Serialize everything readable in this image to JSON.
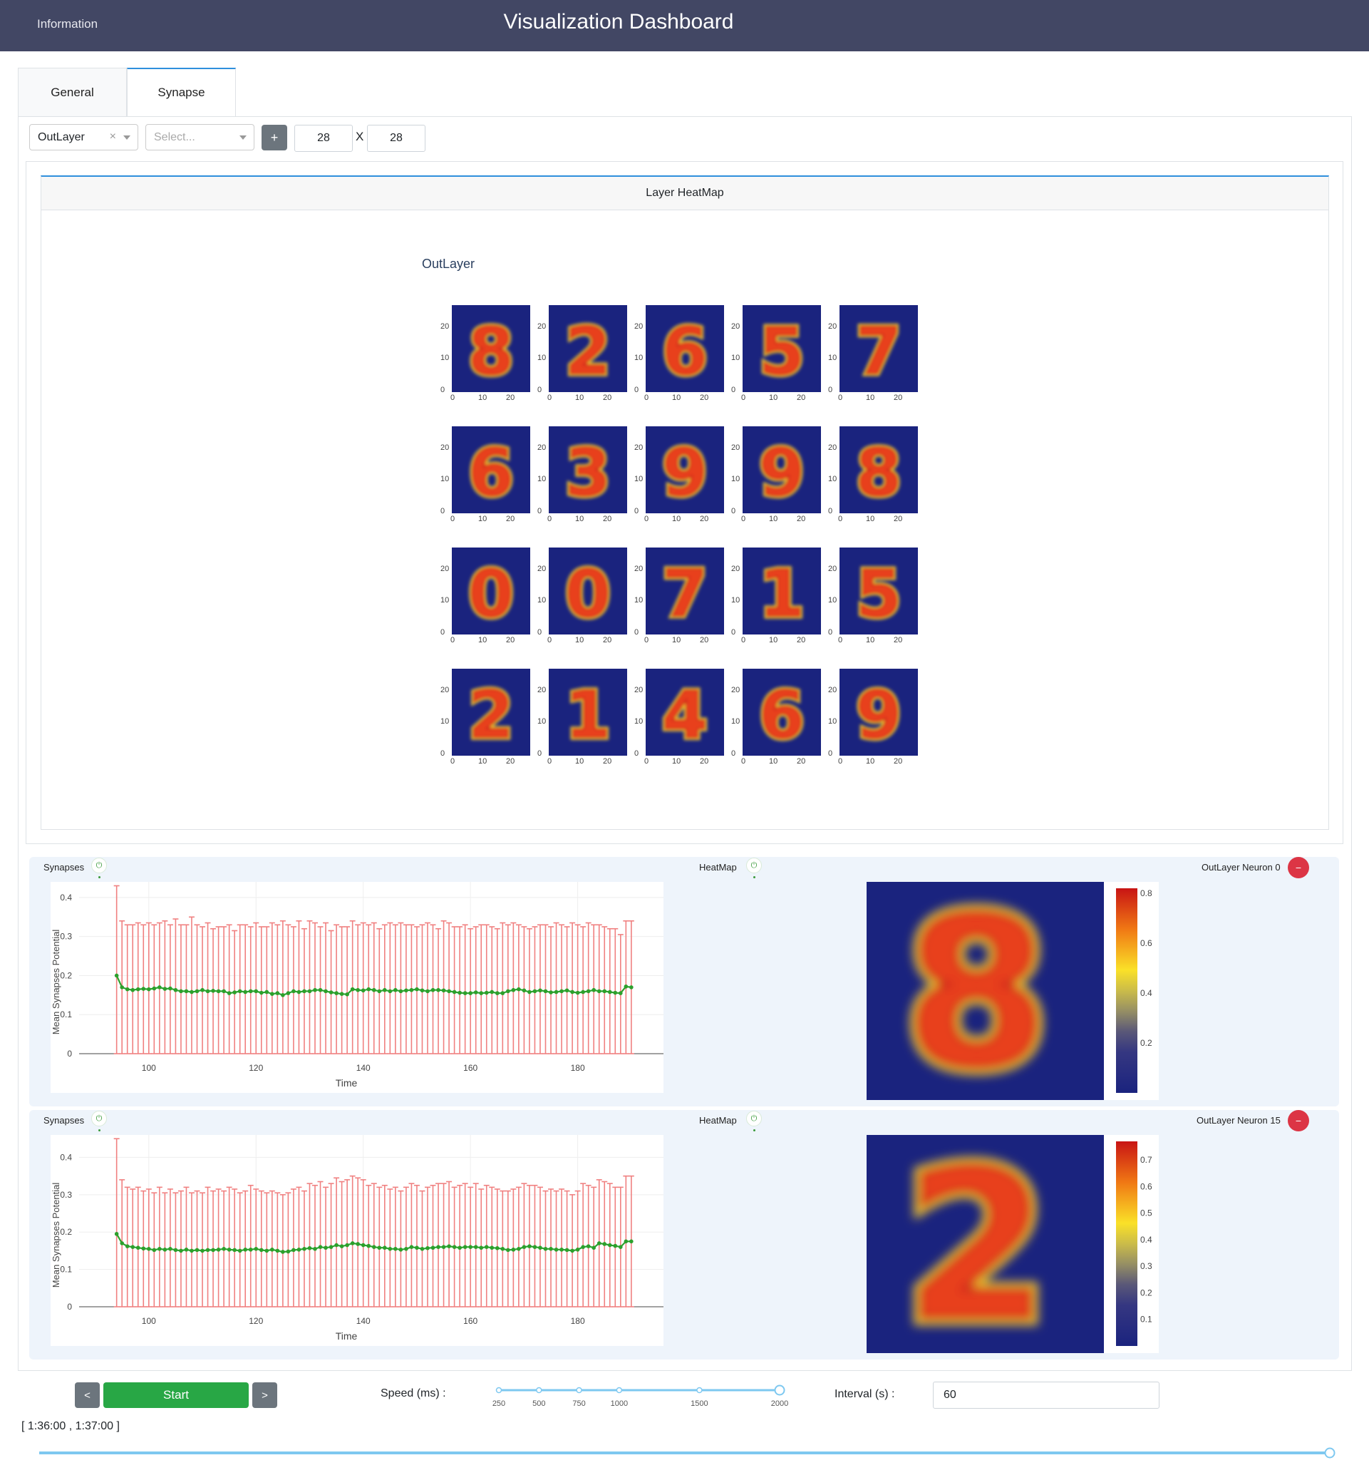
{
  "header": {
    "info_link": "Information",
    "title": "Visualization Dashboard"
  },
  "tabs": [
    {
      "label": "General",
      "active": false
    },
    {
      "label": "Synapse",
      "active": true
    }
  ],
  "controls": {
    "layer_select_value": "OutLayer",
    "neuron_select_placeholder": "Select...",
    "add_label": "+",
    "width_value": "28",
    "times_label": "X",
    "height_value": "28"
  },
  "heatmap_card": {
    "header": "Layer HeatMap",
    "grid_title": "OutLayer",
    "digits": [
      [
        "8",
        "2",
        "6",
        "5",
        "7"
      ],
      [
        "6",
        "3",
        "9",
        "9",
        "8"
      ],
      [
        "0",
        "0",
        "7",
        "1",
        "5"
      ],
      [
        "2",
        "1",
        "4",
        "6",
        "9"
      ]
    ],
    "y_ticks": [
      "20",
      "10",
      "0"
    ],
    "x_ticks": [
      "0",
      "10",
      "20"
    ]
  },
  "rows": [
    {
      "synapses_label": "Synapses",
      "heatmap_label": "HeatMap",
      "neuron_label": "OutLayer Neuron 0",
      "remove_label": "−",
      "power_icon": "⏻",
      "digit": "8",
      "colorbar_ticks": [
        "0.8",
        "0.6",
        "0.4",
        "0.2"
      ],
      "colorbar_max": 0.82,
      "colorbar_values": [
        0.8,
        0.6,
        0.4,
        0.2
      ]
    },
    {
      "synapses_label": "Synapses",
      "heatmap_label": "HeatMap",
      "neuron_label": "OutLayer Neuron 15",
      "remove_label": "−",
      "power_icon": "⏻",
      "digit": "2",
      "colorbar_ticks": [
        "0.7",
        "0.6",
        "0.5",
        "0.4",
        "0.3",
        "0.2",
        "0.1"
      ],
      "colorbar_max": 0.77,
      "colorbar_values": [
        0.7,
        0.6,
        0.5,
        0.4,
        0.3,
        0.2,
        0.1
      ]
    }
  ],
  "chart_data": [
    {
      "type": "line",
      "title": "",
      "xlabel": "Time",
      "ylabel": "Mean Synapses Potential",
      "xlim": [
        87,
        196
      ],
      "ylim": [
        0,
        0.44
      ],
      "x_ticks": [
        100,
        120,
        140,
        160,
        180
      ],
      "y_ticks": [
        0,
        0.1,
        0.2,
        0.3,
        0.4
      ],
      "x": [
        94,
        95,
        96,
        97,
        98,
        99,
        100,
        101,
        102,
        103,
        104,
        105,
        106,
        107,
        108,
        109,
        110,
        111,
        112,
        113,
        114,
        115,
        116,
        117,
        118,
        119,
        120,
        121,
        122,
        123,
        124,
        125,
        126,
        127,
        128,
        129,
        130,
        131,
        132,
        133,
        134,
        135,
        136,
        137,
        138,
        139,
        140,
        141,
        142,
        143,
        144,
        145,
        146,
        147,
        148,
        149,
        150,
        151,
        152,
        153,
        154,
        155,
        156,
        157,
        158,
        159,
        160,
        161,
        162,
        163,
        164,
        165,
        166,
        167,
        168,
        169,
        170,
        171,
        172,
        173,
        174,
        175,
        176,
        177,
        178,
        179,
        180,
        181,
        182,
        183,
        184,
        185,
        186,
        187,
        188,
        189,
        190
      ],
      "mean": [
        0.2,
        0.17,
        0.165,
        0.163,
        0.165,
        0.166,
        0.165,
        0.167,
        0.17,
        0.166,
        0.167,
        0.163,
        0.16,
        0.16,
        0.158,
        0.16,
        0.163,
        0.16,
        0.161,
        0.16,
        0.16,
        0.155,
        0.157,
        0.16,
        0.158,
        0.16,
        0.16,
        0.156,
        0.158,
        0.153,
        0.155,
        0.15,
        0.155,
        0.16,
        0.158,
        0.16,
        0.16,
        0.163,
        0.163,
        0.16,
        0.157,
        0.155,
        0.153,
        0.152,
        0.165,
        0.163,
        0.162,
        0.165,
        0.163,
        0.16,
        0.163,
        0.16,
        0.163,
        0.16,
        0.162,
        0.163,
        0.165,
        0.162,
        0.16,
        0.163,
        0.163,
        0.162,
        0.16,
        0.158,
        0.156,
        0.155,
        0.155,
        0.157,
        0.155,
        0.156,
        0.158,
        0.155,
        0.155,
        0.16,
        0.163,
        0.165,
        0.162,
        0.158,
        0.16,
        0.162,
        0.16,
        0.157,
        0.158,
        0.16,
        0.162,
        0.158,
        0.156,
        0.158,
        0.16,
        0.163,
        0.16,
        0.16,
        0.158,
        0.156,
        0.155,
        0.172,
        0.17
      ],
      "upper": [
        0.43,
        0.34,
        0.33,
        0.33,
        0.335,
        0.33,
        0.335,
        0.33,
        0.335,
        0.34,
        0.33,
        0.345,
        0.33,
        0.33,
        0.35,
        0.33,
        0.325,
        0.335,
        0.32,
        0.325,
        0.325,
        0.33,
        0.315,
        0.33,
        0.33,
        0.325,
        0.335,
        0.325,
        0.325,
        0.335,
        0.33,
        0.34,
        0.33,
        0.325,
        0.34,
        0.32,
        0.34,
        0.335,
        0.325,
        0.335,
        0.315,
        0.33,
        0.325,
        0.325,
        0.34,
        0.33,
        0.335,
        0.33,
        0.335,
        0.32,
        0.33,
        0.335,
        0.33,
        0.335,
        0.33,
        0.33,
        0.325,
        0.33,
        0.335,
        0.33,
        0.32,
        0.34,
        0.335,
        0.325,
        0.325,
        0.33,
        0.32,
        0.325,
        0.33,
        0.33,
        0.325,
        0.32,
        0.335,
        0.33,
        0.335,
        0.33,
        0.325,
        0.32,
        0.325,
        0.33,
        0.33,
        0.325,
        0.335,
        0.33,
        0.325,
        0.335,
        0.33,
        0.325,
        0.335,
        0.33,
        0.33,
        0.325,
        0.32,
        0.32,
        0.305,
        0.34,
        0.34
      ],
      "lower": 0.0
    },
    {
      "type": "line",
      "title": "",
      "xlabel": "Time",
      "ylabel": "Mean Synapses Potential",
      "xlim": [
        87,
        196
      ],
      "ylim": [
        0,
        0.46
      ],
      "x_ticks": [
        100,
        120,
        140,
        160,
        180
      ],
      "y_ticks": [
        0,
        0.1,
        0.2,
        0.3,
        0.4
      ],
      "x": [
        94,
        95,
        96,
        97,
        98,
        99,
        100,
        101,
        102,
        103,
        104,
        105,
        106,
        107,
        108,
        109,
        110,
        111,
        112,
        113,
        114,
        115,
        116,
        117,
        118,
        119,
        120,
        121,
        122,
        123,
        124,
        125,
        126,
        127,
        128,
        129,
        130,
        131,
        132,
        133,
        134,
        135,
        136,
        137,
        138,
        139,
        140,
        141,
        142,
        143,
        144,
        145,
        146,
        147,
        148,
        149,
        150,
        151,
        152,
        153,
        154,
        155,
        156,
        157,
        158,
        159,
        160,
        161,
        162,
        163,
        164,
        165,
        166,
        167,
        168,
        169,
        170,
        171,
        172,
        173,
        174,
        175,
        176,
        177,
        178,
        179,
        180,
        181,
        182,
        183,
        184,
        185,
        186,
        187,
        188,
        189,
        190
      ],
      "mean": [
        0.195,
        0.17,
        0.162,
        0.16,
        0.158,
        0.156,
        0.155,
        0.152,
        0.155,
        0.153,
        0.155,
        0.152,
        0.15,
        0.153,
        0.15,
        0.152,
        0.15,
        0.152,
        0.152,
        0.153,
        0.155,
        0.153,
        0.152,
        0.15,
        0.153,
        0.153,
        0.155,
        0.152,
        0.15,
        0.153,
        0.15,
        0.147,
        0.148,
        0.152,
        0.153,
        0.155,
        0.157,
        0.155,
        0.16,
        0.158,
        0.16,
        0.165,
        0.162,
        0.165,
        0.17,
        0.168,
        0.165,
        0.163,
        0.16,
        0.158,
        0.158,
        0.155,
        0.155,
        0.153,
        0.155,
        0.16,
        0.158,
        0.155,
        0.157,
        0.158,
        0.16,
        0.16,
        0.162,
        0.16,
        0.158,
        0.16,
        0.16,
        0.16,
        0.158,
        0.16,
        0.158,
        0.157,
        0.155,
        0.152,
        0.153,
        0.155,
        0.16,
        0.162,
        0.16,
        0.158,
        0.155,
        0.155,
        0.153,
        0.153,
        0.152,
        0.15,
        0.153,
        0.16,
        0.162,
        0.158,
        0.17,
        0.168,
        0.165,
        0.163,
        0.16,
        0.175,
        0.175
      ],
      "upper": [
        0.45,
        0.34,
        0.32,
        0.315,
        0.32,
        0.31,
        0.315,
        0.305,
        0.32,
        0.305,
        0.315,
        0.305,
        0.31,
        0.32,
        0.305,
        0.31,
        0.305,
        0.32,
        0.31,
        0.315,
        0.31,
        0.32,
        0.315,
        0.305,
        0.31,
        0.325,
        0.315,
        0.31,
        0.305,
        0.31,
        0.305,
        0.3,
        0.305,
        0.315,
        0.32,
        0.31,
        0.33,
        0.325,
        0.335,
        0.32,
        0.33,
        0.345,
        0.335,
        0.34,
        0.35,
        0.345,
        0.34,
        0.325,
        0.33,
        0.32,
        0.325,
        0.315,
        0.32,
        0.31,
        0.32,
        0.33,
        0.325,
        0.31,
        0.32,
        0.325,
        0.33,
        0.33,
        0.335,
        0.32,
        0.325,
        0.33,
        0.32,
        0.33,
        0.315,
        0.325,
        0.32,
        0.315,
        0.31,
        0.31,
        0.315,
        0.32,
        0.33,
        0.325,
        0.325,
        0.32,
        0.31,
        0.315,
        0.31,
        0.315,
        0.31,
        0.3,
        0.31,
        0.33,
        0.325,
        0.32,
        0.34,
        0.335,
        0.33,
        0.32,
        0.32,
        0.35,
        0.35
      ],
      "lower": 0.0
    }
  ],
  "playback": {
    "prev_label": "<",
    "start_label": "Start",
    "next_label": ">",
    "speed_label": "Speed (ms) :",
    "speed_ticks": [
      "250",
      "500",
      "750",
      "1000",
      "1500",
      "2000"
    ],
    "speed_value": 2000,
    "interval_label": "Interval (s) :",
    "interval_value": "60",
    "range_label": "[ 1:36:00 , 1:37:00 ]",
    "timeline_fraction": 1.0
  },
  "colors": {
    "header_bg": "#424764",
    "accent": "#2f8fdc",
    "start_green": "#28a745",
    "remove_red": "#dc3545",
    "errorbar": "#f08080",
    "mean_line": "#2ca02c",
    "heat_low": "#1a237e"
  }
}
